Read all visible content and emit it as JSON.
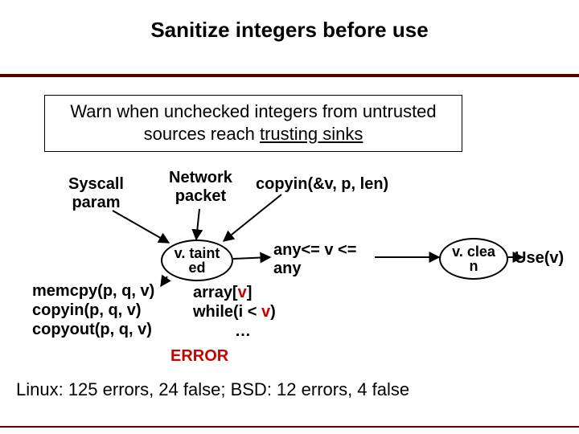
{
  "title": "Sanitize integers before use",
  "warn": {
    "line1": "Warn when unchecked integers from untrusted",
    "line2_a": "sources reach ",
    "line2_b": "trusting sinks"
  },
  "labels": {
    "syscall": "Syscall\nparam",
    "network": "Network\npacket",
    "copyin": "copyin(&v, p, len)"
  },
  "ovals": {
    "tainted": "v. taint\ned",
    "clean": "v. clea\nn"
  },
  "guard": "any<= v <=\nany",
  "sinks": {
    "memcpy": "memcpy(p, q, v)",
    "copyin2": "copyin(p, q, v)",
    "copyout": "copyout(p, q, v)"
  },
  "uses": {
    "array_a": "array[",
    "array_v": "v",
    "array_b": "]",
    "while_a": "while(i < ",
    "while_v": "v",
    "while_b": ")",
    "dots": "…"
  },
  "use_v": "Use(v)",
  "error": "ERROR",
  "footer": "Linux: 125 errors, 24 false; BSD: 12 errors, 4 false",
  "chart_data": {
    "type": "table",
    "title": "Error counts",
    "series": [
      {
        "name": "Linux",
        "errors": 125,
        "false": 24
      },
      {
        "name": "BSD",
        "errors": 12,
        "false": 4
      }
    ]
  }
}
